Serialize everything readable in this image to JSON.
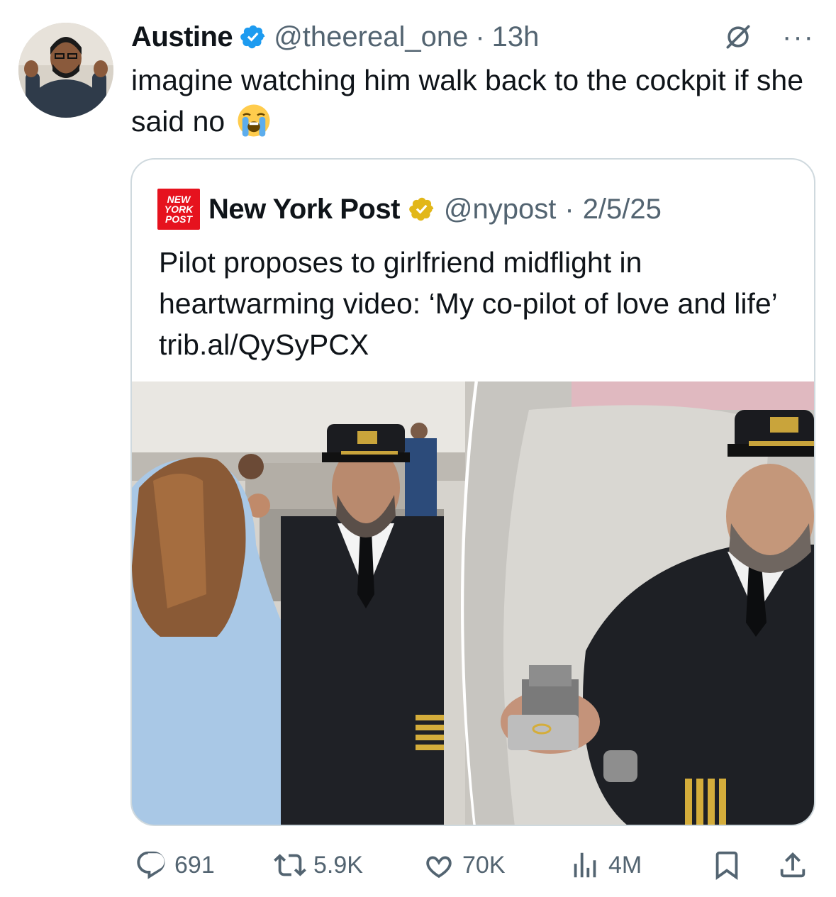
{
  "tweet": {
    "author_name": "Austine",
    "handle": "@theereal_one",
    "time": "13h",
    "text": "imagine watching him walk back to the cockpit if she said no",
    "emoji": "loudly-crying-face",
    "more_label": "···"
  },
  "quoted": {
    "logo_lines": [
      "NEW",
      "YORK",
      "POST"
    ],
    "author_name": "New York Post",
    "handle": "@nypost",
    "date": "2/5/25",
    "text": "Pilot proposes to girlfriend midflight in heartwarming video: ‘My co-pilot of love and life’ trib.al/QySyPCX"
  },
  "actions": {
    "replies": "691",
    "reposts": "5.9K",
    "likes": "70K",
    "views": "4M"
  },
  "icons": {
    "verified_author": "verified-blue-icon",
    "verified_quoted": "verified-gold-icon",
    "grok": "grok-icon",
    "reply": "reply-icon",
    "repost": "repost-icon",
    "like": "heart-icon",
    "views": "views-icon",
    "bookmark": "bookmark-icon",
    "share": "share-icon"
  },
  "colors": {
    "text": "#0f1419",
    "muted": "#536471",
    "verified_blue": "#1d9bf0",
    "verified_gold": "#e2b719",
    "nypost_red": "#e6121e",
    "border": "#cfd9de"
  }
}
